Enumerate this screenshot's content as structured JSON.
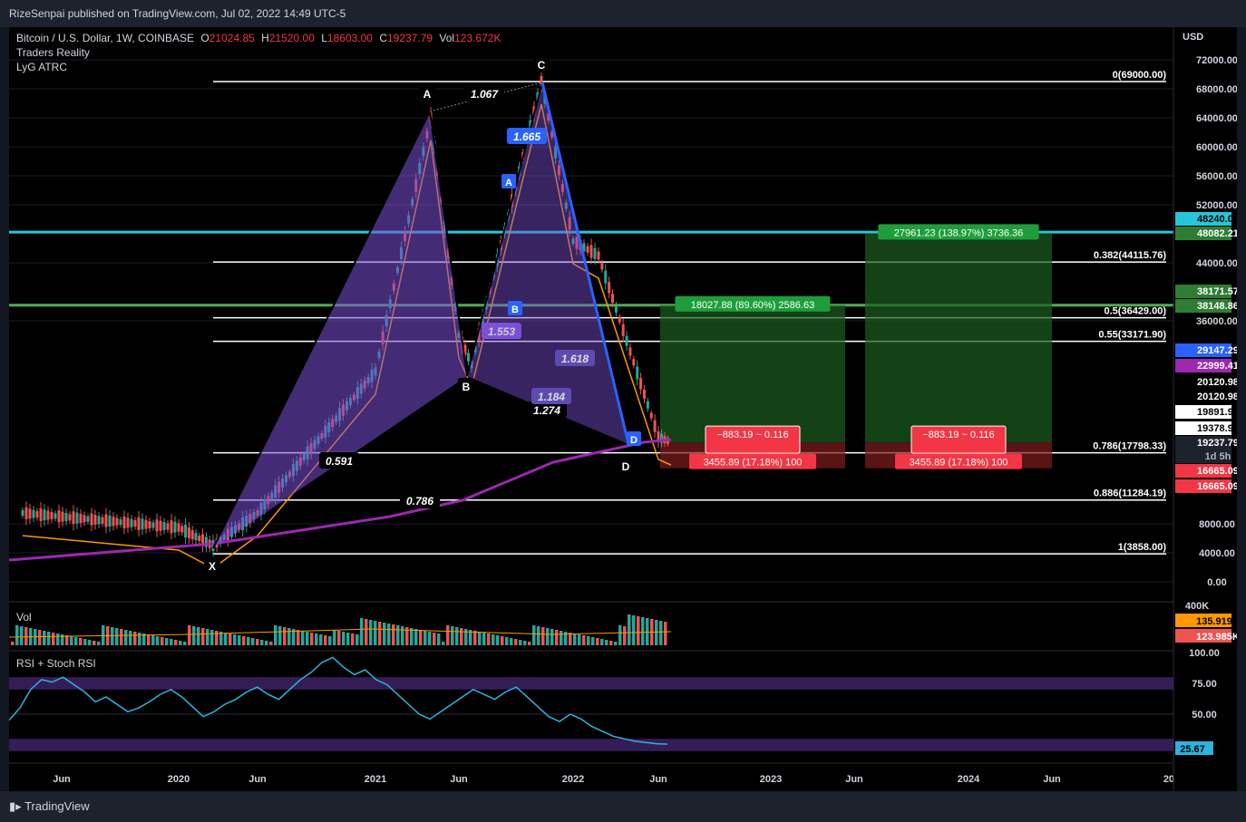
{
  "header": {
    "published": "RizeSenpai published on TradingView.com, Jul 02, 2022 14:49 UTC-5"
  },
  "legend": {
    "symbol": "Bitcoin / U.S. Dollar, 1W, COINBASE",
    "o_label": "O",
    "o_value": "21024.85",
    "h_label": "H",
    "h_value": "21520.00",
    "l_label": "L",
    "l_value": "18603.00",
    "c_label": "C",
    "c_value": "19237.79",
    "vol_label": "Vol",
    "vol_value": "123.672K",
    "indicator1": "Traders Reality",
    "indicator2": "LyG ATRC"
  },
  "vol_pane": {
    "label": "Vol"
  },
  "rsi_pane": {
    "label": "RSI + Stoch RSI"
  },
  "footer": {
    "brand": "TradingView"
  },
  "colors": {
    "bg": "#000000",
    "up": "#26a69a",
    "down": "#ef5350",
    "pattern": "#7b4fd6",
    "cyan": "#26c6da",
    "green_level": "#4caf50",
    "rsi": "#2bb4e0"
  },
  "chart_data": {
    "type": "candlestick",
    "symbol": "Bitcoin / U.S. Dollar, 1W, COINBASE",
    "price_axis_unit": "USD",
    "price_ticks": [
      72000,
      68000,
      64000,
      60000,
      56000,
      52000,
      44000,
      36000,
      8000,
      4000,
      0
    ],
    "price_tick_labels": [
      "72000.00",
      "68000.00",
      "64000.00",
      "60000.00",
      "56000.00",
      "52000.00",
      "44000.00",
      "36000.00",
      "8000.00",
      "4000.00",
      "0.00"
    ],
    "time_ticks": [
      "Jun",
      "2020",
      "Jun",
      "2021",
      "Jun",
      "2022",
      "Jun",
      "2023",
      "Jun",
      "2024",
      "Jun",
      "202"
    ],
    "ohlc_last": {
      "open": 21024.85,
      "high": 21520.0,
      "low": 18603.0,
      "close": 19237.79,
      "volume": "123.672K"
    },
    "price_path": [
      [
        "Jun",
        9500
      ],
      [
        "2020",
        7500
      ],
      [
        "Mar 2020",
        5000
      ],
      [
        "Jun",
        9500
      ],
      [
        "2021",
        29000
      ],
      [
        "Apr 2021",
        64000
      ],
      [
        "Jun",
        34000
      ],
      [
        "Jul 2021",
        30000
      ],
      [
        "Nov 2021",
        69000
      ],
      [
        "2022",
        47000
      ],
      [
        "Mar 2022",
        45000
      ],
      [
        "Jun",
        20000
      ],
      [
        "Jul 2022",
        19237.79
      ]
    ],
    "pattern": {
      "points": [
        {
          "label": "X",
          "price": 3858
        },
        {
          "label": "A",
          "price": 64800
        },
        {
          "label": "B",
          "price": 28800
        },
        {
          "label": "C",
          "price": 69000
        },
        {
          "label": "D",
          "price": 17800
        }
      ],
      "ratios": [
        "1.067",
        "0.591",
        "0.786",
        "1.274",
        "1.665",
        "1.553",
        "1.618",
        "1.184"
      ],
      "inner_labels": [
        "A",
        "B",
        "D"
      ]
    },
    "fib_levels": [
      {
        "label": "0(69000.00)",
        "price": 69000
      },
      {
        "label": "0.382(44115.76)",
        "price": 44115.76
      },
      {
        "label": "0.5(36429.00)",
        "price": 36429
      },
      {
        "label": "0.55(33171.90)",
        "price": 33171.9
      },
      {
        "label": "0.786(17798.33)",
        "price": 17798.33
      },
      {
        "label": "0.886(11284.19)",
        "price": 11284.19
      },
      {
        "label": "1(3858.00)",
        "price": 3858
      }
    ],
    "horizontal_levels": [
      {
        "name": "cyan",
        "price": 48240,
        "color": "#26c6da"
      },
      {
        "name": "green",
        "price": 38148.86,
        "color": "#4caf50"
      }
    ],
    "positions": [
      {
        "target": "18027.88 (89.60%) 2586.63",
        "center": "−883.19 ~ 0.116",
        "stop": "3455.89 (17.18%) 100"
      },
      {
        "target": "27961.23 (138.97%) 3736.36",
        "center": "−883.19 ~ 0.116",
        "stop": "3455.89 (17.18%) 100"
      }
    ],
    "price_labels": [
      {
        "text": "48240.00",
        "price": 48240,
        "bg": "#26c6da",
        "fg": "#000000"
      },
      {
        "text": "48082.21",
        "price": 48082.21,
        "bg": "#2e7d32",
        "fg": "#ffffff"
      },
      {
        "text": "38171.57",
        "price": 38171.57,
        "bg": "#2e7d32",
        "fg": "#ffffff"
      },
      {
        "text": "38148.86",
        "price": 38148.86,
        "bg": "#2e7d32",
        "fg": "#ffffff"
      },
      {
        "text": "29147.29",
        "price": 29147.29,
        "bg": "#2962ff",
        "fg": "#ffffff"
      },
      {
        "text": "22999.41",
        "price": 22999.41,
        "bg": "#9c27b0",
        "fg": "#ffffff"
      },
      {
        "text": "20120.98",
        "price": 20120.98,
        "bg": "#000000",
        "fg": "#ffffff"
      },
      {
        "text": "20120.98",
        "price": 20120.98,
        "bg": "#000000",
        "fg": "#ffffff"
      },
      {
        "text": "19891.99",
        "price": 19891.99,
        "bg": "#ffffff",
        "fg": "#000000"
      },
      {
        "text": "19378.99",
        "price": 19378.99,
        "bg": "#ffffff",
        "fg": "#000000"
      },
      {
        "text": "19237.79",
        "price": 19237.79,
        "bg": "#1e222d",
        "fg": "#ffffff"
      },
      {
        "text": "1d 5h",
        "price": 18000,
        "bg": "#1e222d",
        "fg": "#b2b5be"
      },
      {
        "text": "16665.09",
        "price": 16665.09,
        "bg": "#f23645",
        "fg": "#ffffff"
      },
      {
        "text": "16665.09",
        "price": 16665.09,
        "bg": "#f23645",
        "fg": "#ffffff"
      }
    ],
    "volume": {
      "axis_top": "400K",
      "labels": [
        "135.919K",
        "123.985K"
      ]
    },
    "rsi": {
      "ticks": [
        "100.00",
        "75.00",
        "50.00"
      ],
      "last": "25.67",
      "band_upper": 75,
      "band_lower": 25,
      "values": [
        45,
        55,
        70,
        78,
        76,
        80,
        74,
        68,
        60,
        64,
        58,
        52,
        55,
        60,
        66,
        70,
        64,
        56,
        48,
        52,
        58,
        62,
        68,
        72,
        66,
        62,
        70,
        78,
        84,
        92,
        96,
        88,
        82,
        86,
        78,
        74,
        66,
        58,
        50,
        46,
        52,
        58,
        64,
        70,
        66,
        62,
        68,
        72,
        64,
        56,
        48,
        44,
        50,
        46,
        40,
        36,
        32,
        30,
        28,
        27,
        26,
        25.67
      ]
    }
  }
}
